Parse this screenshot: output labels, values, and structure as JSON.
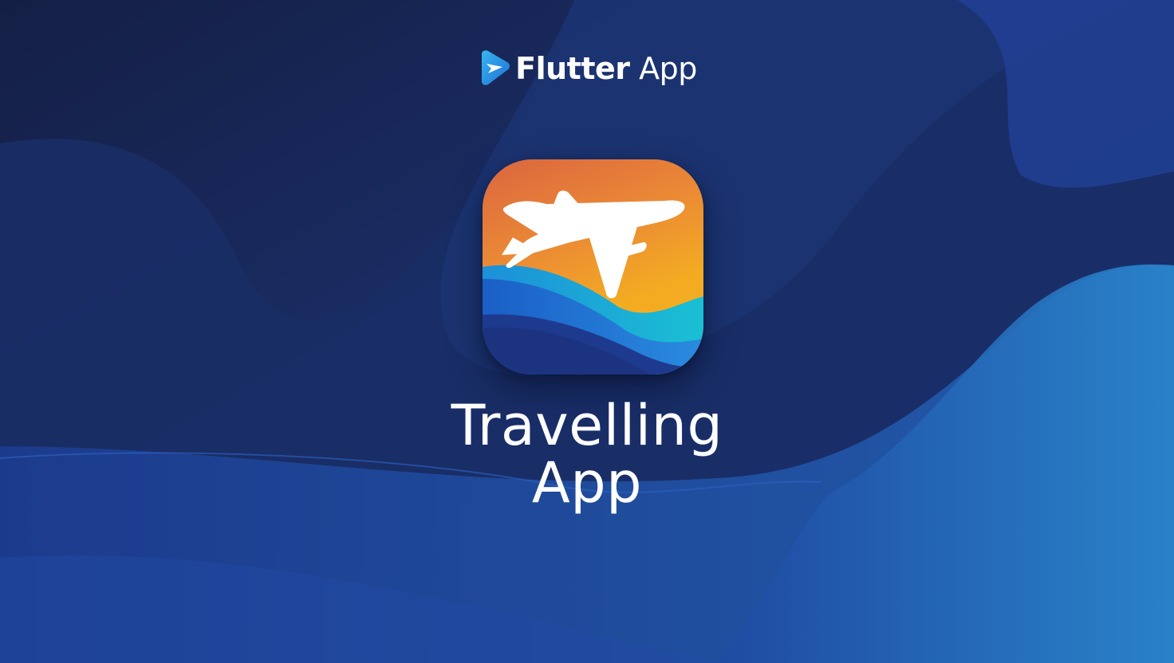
{
  "header": {
    "logo_icon": "flutter-logo-icon",
    "brand_word_1": "Flutter",
    "brand_word_2": "App"
  },
  "app_icon": {
    "icon": "airplane-icon",
    "gradient_top": "#dc6a3e",
    "gradient_mid": "#f0a22a",
    "wave_light": "#1bb8d6",
    "wave_mid": "#1e6fd0",
    "wave_dark": "#1e3a8a"
  },
  "title": {
    "line_1": "Travelling",
    "line_2": "App"
  },
  "colors": {
    "background_dark": "#15244f",
    "background_mid": "#1f3a86",
    "background_light": "#2a7fc8",
    "text": "#ffffff"
  }
}
